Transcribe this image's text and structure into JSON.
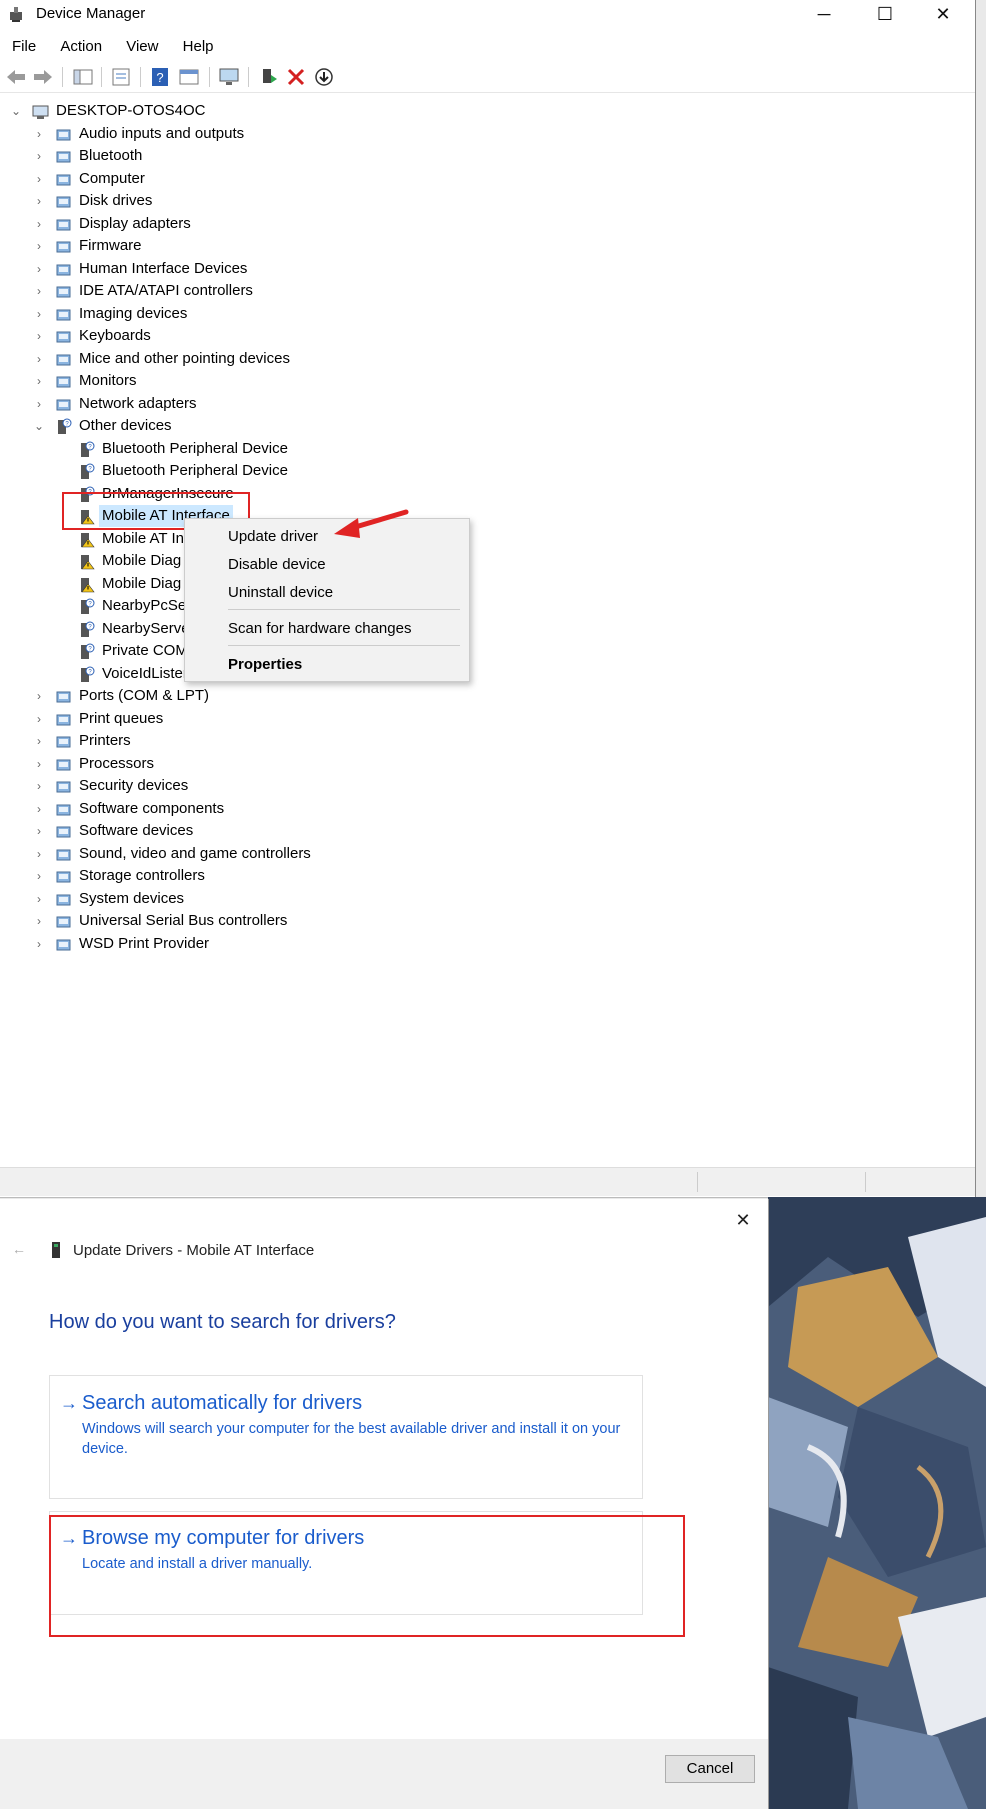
{
  "device_manager": {
    "title": "Device Manager",
    "window_buttons": {
      "minimize": "─",
      "maximize": "☐",
      "close": "✕"
    },
    "menu": [
      "File",
      "Action",
      "View",
      "Help"
    ],
    "tree": {
      "root": "DESKTOP-OTOS4OC",
      "categories_before": [
        "Audio inputs and outputs",
        "Bluetooth",
        "Computer",
        "Disk drives",
        "Display adapters",
        "Firmware",
        "Human Interface Devices",
        "IDE ATA/ATAPI controllers",
        "Imaging devices",
        "Keyboards",
        "Mice and other pointing devices",
        "Monitors",
        "Network adapters"
      ],
      "expanded_category": "Other devices",
      "other_devices": [
        "Bluetooth Peripheral Device",
        "Bluetooth Peripheral Device",
        "BrManagerInsecure",
        "Mobile AT Interface",
        "Mobile AT In",
        "Mobile Diag",
        "Mobile Diag",
        "NearbyPcSer",
        "NearbyServe",
        "Private COM",
        "VoiceIdLister"
      ],
      "categories_after": [
        "Ports (COM & LPT)",
        "Print queues",
        "Printers",
        "Processors",
        "Security devices",
        "Software components",
        "Software devices",
        "Sound, video and game controllers",
        "Storage controllers",
        "System devices",
        "Universal Serial Bus controllers",
        "WSD Print Provider"
      ]
    },
    "context_menu": {
      "update_driver": "Update driver",
      "disable_device": "Disable device",
      "uninstall_device": "Uninstall device",
      "scan": "Scan for hardware changes",
      "properties": "Properties"
    }
  },
  "update_dialog": {
    "close": "✕",
    "back": "←",
    "title": "Update Drivers - Mobile AT Interface",
    "heading": "How do you want to search for drivers?",
    "option_auto": {
      "arrow": "→",
      "title": "Search automatically for drivers",
      "description": "Windows will search your computer for the best available driver and install it on your device."
    },
    "option_browse": {
      "arrow": "→",
      "title": "Browse my computer for drivers",
      "description": "Locate and install a driver manually."
    },
    "cancel": "Cancel"
  },
  "colors": {
    "accent_link": "#1a5ccc",
    "heading": "#1a3f9e",
    "annotation_red": "#e02424",
    "selection": "#cce8ff"
  }
}
